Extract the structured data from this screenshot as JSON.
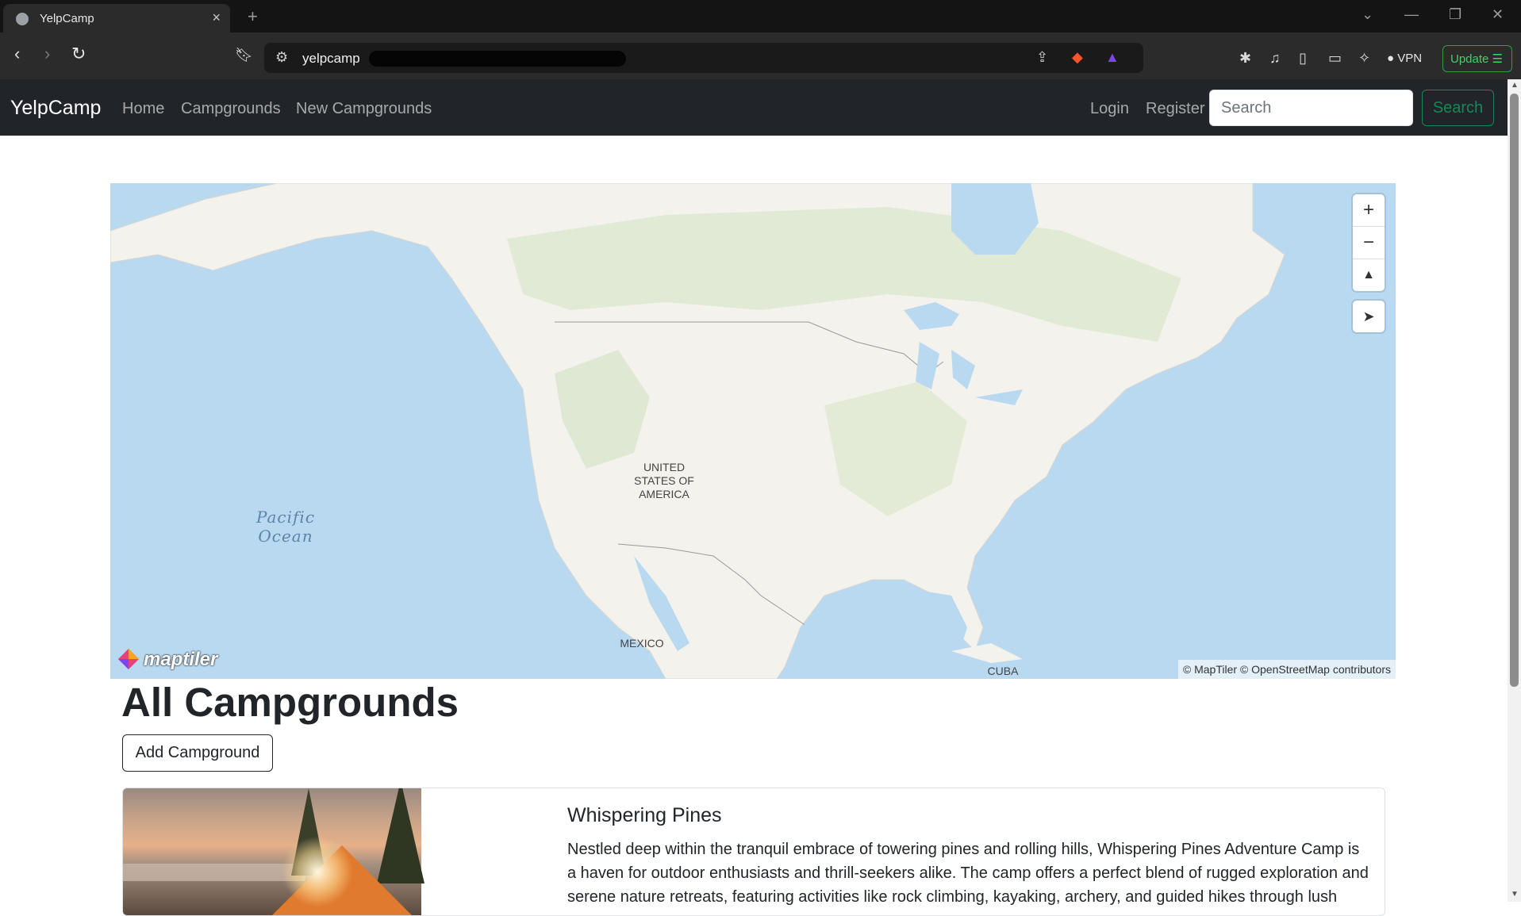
{
  "browser": {
    "tab_title": "YelpCamp",
    "url": "yelpcamp",
    "vpn_label": "VPN",
    "update_label": "Update"
  },
  "navbar": {
    "brand": "YelpCamp",
    "links": [
      "Home",
      "Campgrounds",
      "New Campgrounds"
    ],
    "login": "Login",
    "register": "Register",
    "search_placeholder": "Search",
    "search_button": "Search"
  },
  "map": {
    "labels": {
      "usa": "UNITED STATES OF AMERICA",
      "mexico": "MEXICO",
      "cuba": "CUBA",
      "pacific": "Pacific Ocean"
    },
    "controls": {
      "zoom_in": "+",
      "zoom_out": "−",
      "compass": "▲",
      "geolocate": "➤"
    },
    "logo_text": "maptiler",
    "attribution": "© MapTiler © OpenStreetMap contributors"
  },
  "page": {
    "heading": "All Campgrounds",
    "add_button": "Add Campground"
  },
  "campgrounds": [
    {
      "title": "Whispering Pines",
      "description": "Nestled deep within the tranquil embrace of towering pines and rolling hills, Whispering Pines Adventure Camp is a haven for outdoor enthusiasts and thrill-seekers alike. The camp offers a perfect blend of rugged exploration and serene nature retreats, featuring activities like rock climbing, kayaking, archery, and guided hikes through lush"
    }
  ]
}
